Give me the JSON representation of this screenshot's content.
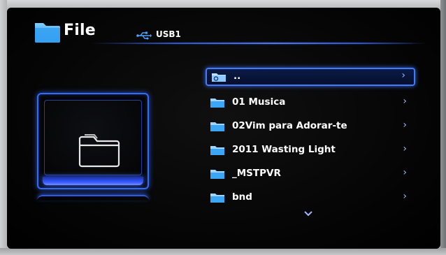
{
  "header": {
    "title": "File",
    "icon": "folder-icon",
    "device_icon": "usb-icon",
    "device_label": "USB1"
  },
  "preview": {
    "icon": "folder-outline-icon"
  },
  "file_list": {
    "items": [
      {
        "label": "..",
        "icon": "parent-folder-icon",
        "selected": true
      },
      {
        "label": "01 Musica",
        "icon": "folder-icon",
        "selected": false
      },
      {
        "label": "02Vim para Adorar-te",
        "icon": "folder-icon",
        "selected": false
      },
      {
        "label": "2011 Wasting Light",
        "icon": "folder-icon",
        "selected": false
      },
      {
        "label": "_MSTPVR",
        "icon": "folder-icon",
        "selected": false
      },
      {
        "label": "bnd",
        "icon": "folder-icon",
        "selected": false
      }
    ],
    "chevron": "›",
    "more_icon": "chevron-down-icon"
  },
  "colors": {
    "accent": "#3f7bff",
    "folder": "#3aa6f5",
    "background": "#050505",
    "text": "#ffffff"
  }
}
